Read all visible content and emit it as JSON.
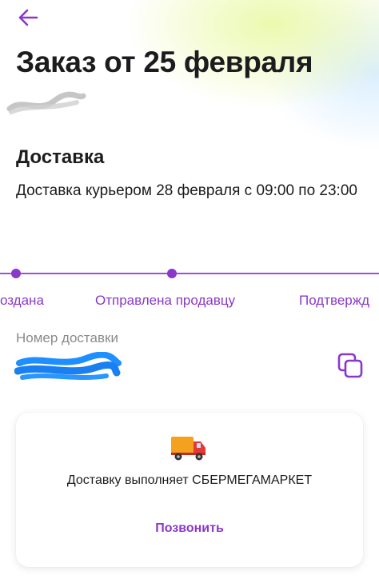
{
  "header": {
    "back_icon": "arrow-left-icon",
    "title": "Заказ от 25 февраля"
  },
  "delivery": {
    "heading": "Доставка",
    "description": "Доставка курьером 28 февраля с 09:00 по 23:00"
  },
  "tracking": {
    "steps": [
      {
        "label": "оздана"
      },
      {
        "label": "Отправлена продавцу"
      },
      {
        "label": "Подтвержд"
      }
    ]
  },
  "delivery_number": {
    "label": "Номер доставки",
    "copy_icon": "copy-icon"
  },
  "courier_card": {
    "icon": "delivery-truck-icon",
    "text": "Доставку выполняет СБЕРМЕГАМАРКЕТ",
    "call_label": "Позвонить"
  },
  "colors": {
    "accent": "#8a38c9",
    "text": "#1c1c1e",
    "muted": "#8a8a8e"
  }
}
